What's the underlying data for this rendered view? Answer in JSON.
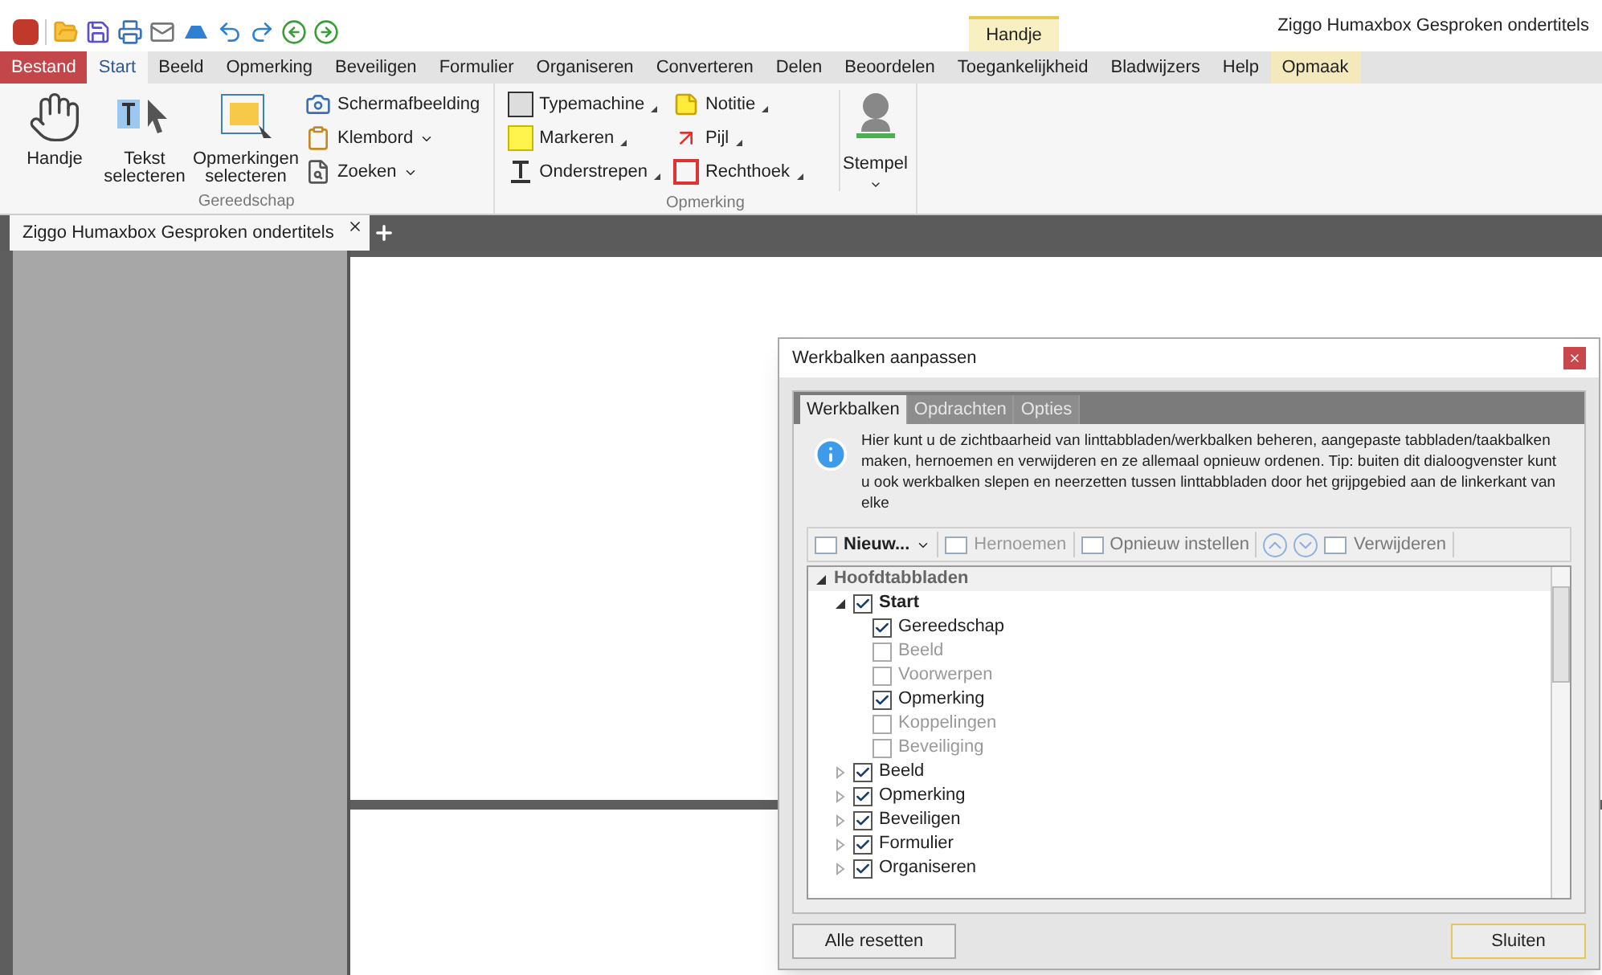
{
  "window": {
    "title": "Ziggo Humaxbox Gesproken ondertitels"
  },
  "contextual_tab": {
    "group": "Handje",
    "tab": "Opmaak",
    "selected": false
  },
  "menu_tabs": [
    {
      "label": "Bestand",
      "kind": "file",
      "selected": false
    },
    {
      "label": "Start",
      "kind": "tab",
      "selected": true
    },
    {
      "label": "Beeld",
      "kind": "tab",
      "selected": false
    },
    {
      "label": "Opmerking",
      "kind": "tab",
      "selected": false
    },
    {
      "label": "Beveiligen",
      "kind": "tab",
      "selected": false
    },
    {
      "label": "Formulier",
      "kind": "tab",
      "selected": false
    },
    {
      "label": "Organiseren",
      "kind": "tab",
      "selected": false
    },
    {
      "label": "Converteren",
      "kind": "tab",
      "selected": false
    },
    {
      "label": "Delen",
      "kind": "tab",
      "selected": false
    },
    {
      "label": "Beoordelen",
      "kind": "tab",
      "selected": false
    },
    {
      "label": "Toegankelijkheid",
      "kind": "tab",
      "selected": false
    },
    {
      "label": "Bladwijzers",
      "kind": "tab",
      "selected": false
    },
    {
      "label": "Help",
      "kind": "tab",
      "selected": false
    }
  ],
  "ribbon": {
    "groups": [
      {
        "label": "Gereedschap",
        "large": [
          {
            "label": "Handje",
            "kind": "hand"
          },
          {
            "label": "Tekst selecteren",
            "kind": "text"
          },
          {
            "label": "Opmerkingen selecteren",
            "kind": "comments"
          }
        ],
        "small": [
          {
            "label": "Schermafbeelding",
            "kind": "camera",
            "dropdown": false
          },
          {
            "label": "Klembord",
            "kind": "clipboard",
            "dropdown": true
          },
          {
            "label": "Zoeken",
            "kind": "search",
            "dropdown": true
          }
        ]
      },
      {
        "label": "Opmerking",
        "small": [
          {
            "label": "Typemachine",
            "kind": "typewriter",
            "dropdown": true
          },
          {
            "label": "Notitie",
            "kind": "note",
            "dropdown": true
          },
          {
            "label": "Markeren",
            "kind": "highlight",
            "dropdown": true
          },
          {
            "label": "Pijl",
            "kind": "arrow",
            "dropdown": true
          },
          {
            "label": "Onderstrepen",
            "kind": "underline",
            "dropdown": true
          },
          {
            "label": "Rechthoek",
            "kind": "rectangle",
            "dropdown": true
          }
        ],
        "extra": [
          {
            "label": "Stempel",
            "kind": "stamp"
          }
        ]
      }
    ]
  },
  "document_tab": {
    "label": "Ziggo Humaxbox Gesproken ondertitels"
  },
  "dialog": {
    "title": "Werkbalken aanpassen",
    "tabs": [
      {
        "label": "Werkbalken",
        "selected": true
      },
      {
        "label": "Opdrachten",
        "selected": false
      },
      {
        "label": "Opties",
        "selected": false
      }
    ],
    "info": "Hier kunt u de zichtbaarheid van linttabbladen/werkbalken beheren, aangepaste tabbladen/taakbalken maken, hernoemen en verwijderen en ze allemaal opnieuw ordenen. Tip: buiten dit dialoogvenster kunt u ook werkbalken slepen en neerzetten tussen linttabbladen door het grijpgebied aan de linkerkant van elke",
    "toolbar": [
      {
        "label": "Nieuw...",
        "disabled": false,
        "dropdown": true
      },
      {
        "label": "Hernoemen",
        "disabled": true,
        "dropdown": false
      },
      {
        "label": "Opnieuw instellen",
        "disabled": false,
        "dropdown": false
      },
      {
        "label": "Verwijderen",
        "disabled": false,
        "dropdown": false
      }
    ],
    "tree": [
      {
        "label": "Hoofdtabbladen",
        "expanded": true,
        "children": [
          {
            "label": "Start",
            "checked": true,
            "expanded": true,
            "children": [
              {
                "label": "Gereedschap",
                "checked": true
              },
              {
                "label": "Beeld",
                "checked": false
              },
              {
                "label": "Voorwerpen",
                "checked": false
              },
              {
                "label": "Opmerking",
                "checked": true
              },
              {
                "label": "Koppelingen",
                "checked": false
              },
              {
                "label": "Beveiliging",
                "checked": false
              }
            ]
          },
          {
            "label": "Beeld",
            "checked": true,
            "expanded": false
          },
          {
            "label": "Opmerking",
            "checked": true,
            "expanded": false
          },
          {
            "label": "Beveiligen",
            "checked": true,
            "expanded": false
          },
          {
            "label": "Formulier",
            "checked": true,
            "expanded": false
          },
          {
            "label": "Organiseren",
            "checked": true,
            "expanded": false
          }
        ]
      }
    ],
    "buttons": [
      {
        "label": "Alle resetten",
        "kind": "secondary"
      },
      {
        "label": "Sluiten",
        "kind": "default"
      }
    ]
  }
}
